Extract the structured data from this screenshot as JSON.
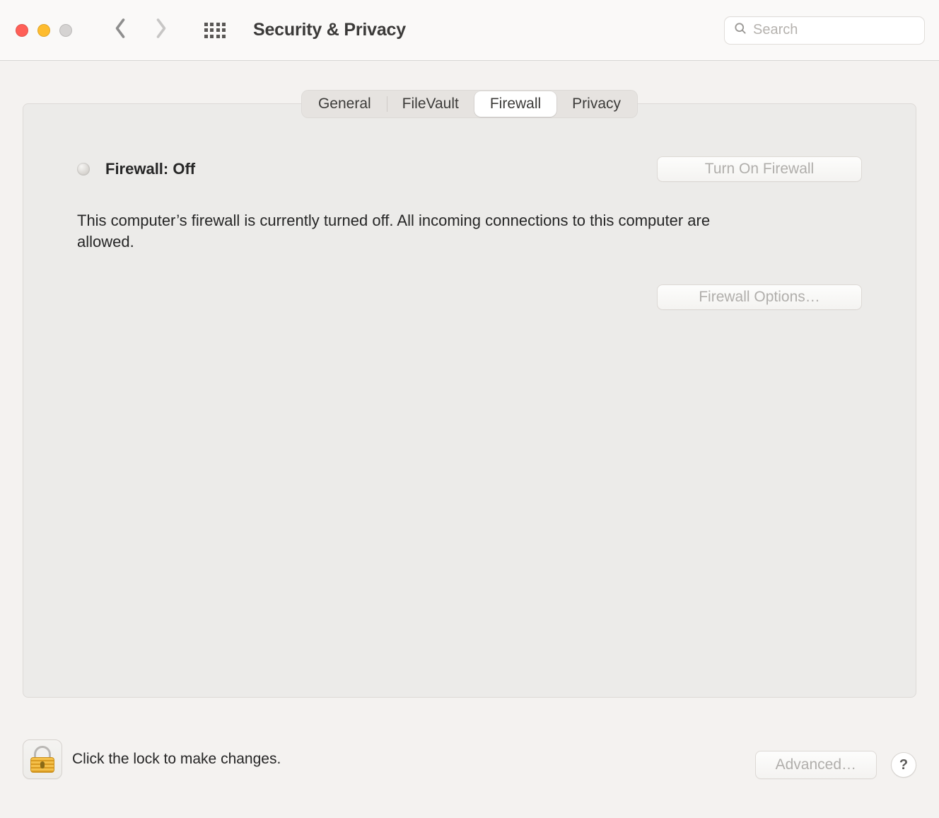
{
  "header": {
    "title": "Security & Privacy",
    "search_placeholder": "Search"
  },
  "tabs": [
    {
      "id": "general",
      "label": "General"
    },
    {
      "id": "filevault",
      "label": "FileVault"
    },
    {
      "id": "firewall",
      "label": "Firewall"
    },
    {
      "id": "privacy",
      "label": "Privacy"
    }
  ],
  "active_tab": "firewall",
  "firewall": {
    "status_label": "Firewall: Off",
    "description": "This computer’s firewall is currently turned off. All incoming connections to this computer are allowed.",
    "turn_on_label": "Turn On Firewall",
    "options_label": "Firewall Options…"
  },
  "footer": {
    "lock_text": "Click the lock to make changes.",
    "advanced_label": "Advanced…",
    "help_label": "?"
  }
}
